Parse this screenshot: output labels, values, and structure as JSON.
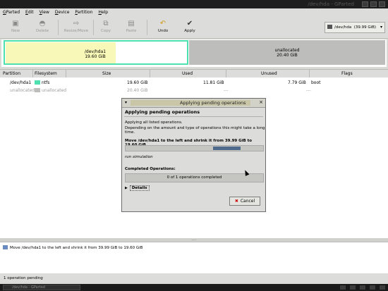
{
  "window": {
    "title": "/dev/hda - GParted"
  },
  "menu": [
    "GParted",
    "Edit",
    "View",
    "Device",
    "Partition",
    "Help"
  ],
  "toolbar": {
    "new": "New",
    "delete": "Delete",
    "resize_move": "Resize/Move",
    "copy": "Copy",
    "paste": "Paste",
    "undo": "Undo",
    "apply": "Apply"
  },
  "device_selector": {
    "label": "/dev/hda",
    "size": "(39.99 GiB)"
  },
  "graph": {
    "part1_name": "/dev/hda1",
    "part1_size": "19.60 GiB",
    "part2_name": "unallocated",
    "part2_size": "20.40 GiB"
  },
  "table": {
    "headers": [
      "Partition",
      "Filesystem",
      "Size",
      "Used",
      "Unused",
      "Flags"
    ],
    "rows": [
      {
        "partition": "/dev/hda1",
        "filesystem": "ntfs",
        "size": "19.60 GiB",
        "used": "11.81 GiB",
        "unused": "7.79 GiB",
        "flags": "boot"
      },
      {
        "partition": "unallocated",
        "filesystem": "unallocated",
        "size": "20.40 GiB",
        "used": "---",
        "unused": "---",
        "flags": ""
      }
    ]
  },
  "operations": {
    "item": "Move /dev/hda1 to the left and shrink it from 39.99 GiB to 19.60 GiB"
  },
  "status": {
    "text": "1 operation pending"
  },
  "taskbar": {
    "task": "/dev/hda - GParted"
  },
  "dialog": {
    "title": "Applying pending operations",
    "heading": "Applying pending operations",
    "line1": "Applying all listed operations.",
    "line2": "Depending on the amount and type of operations this might take a long time.",
    "operation": "Move /dev/hda1 to the left and shrink it from 39.99 GiB to 19.60 GiB",
    "op_progress_fraction": 0.2,
    "sub_status": "run simulation",
    "completed_label": "Completed Operations:",
    "completed_text": "0 of 1 operations completed",
    "details_label": "Details",
    "cancel_label": "Cancel"
  },
  "colors": {
    "ntfs": "#4fe0b0",
    "used": "#f8f8b8",
    "unallocated": "#bdbdbb",
    "progress": "#4d6a8c"
  }
}
